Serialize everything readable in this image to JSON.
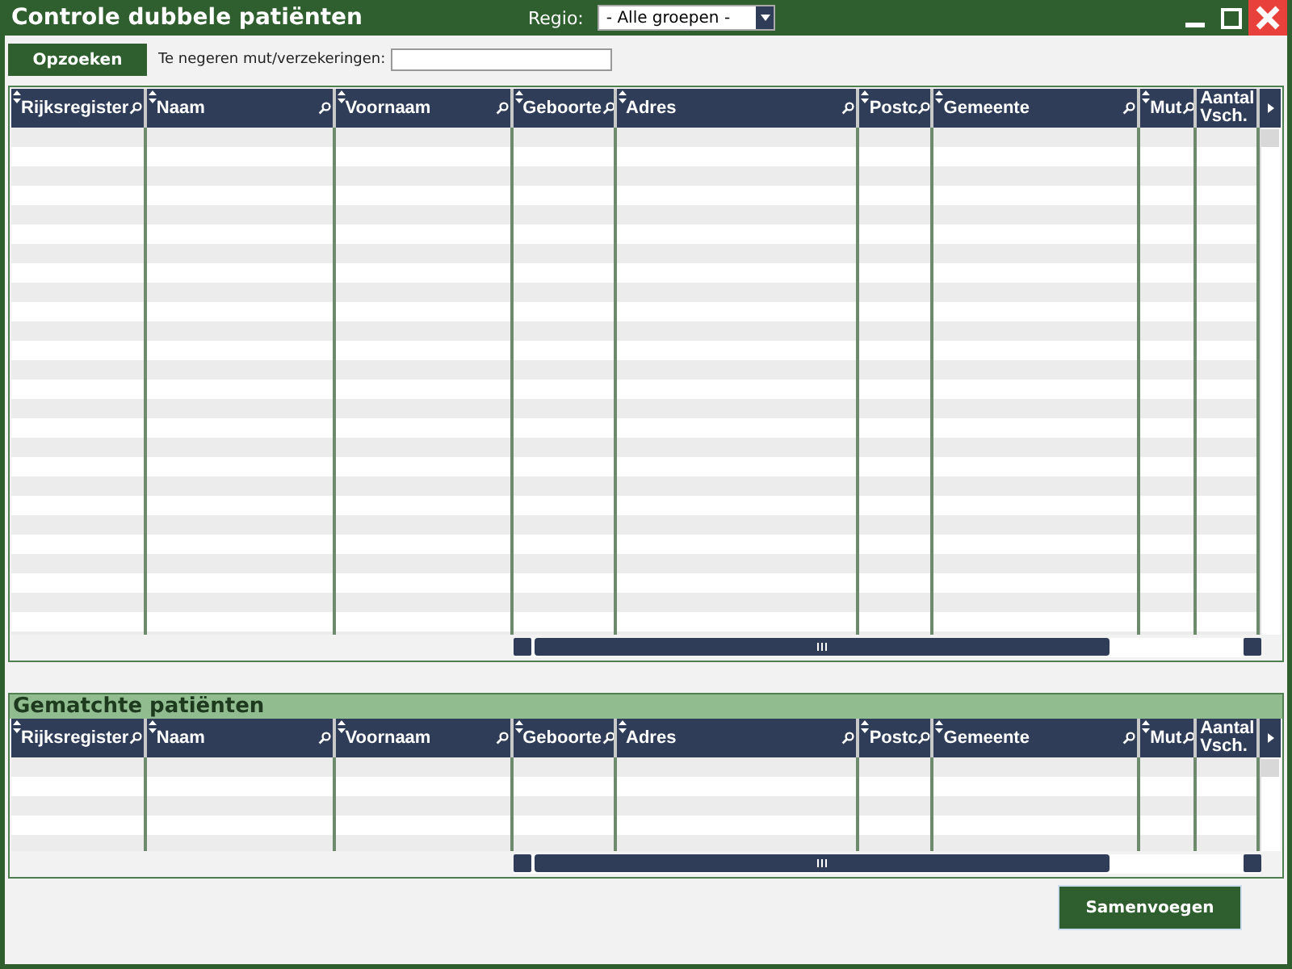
{
  "window": {
    "title": "Controle dubbele patiënten"
  },
  "region": {
    "label": "Regio:",
    "value": "- Alle groepen -"
  },
  "toolbar": {
    "search_button": "Opzoeken",
    "ignore_label": "Te negeren mut/verzekeringen:"
  },
  "grids": [
    {
      "columns": [
        {
          "label": "Rijksregister",
          "filter": true
        },
        {
          "label": "Naam",
          "filter": true
        },
        {
          "label": "Voornaam",
          "filter": true
        },
        {
          "label": "Geboorte",
          "filter": true
        },
        {
          "label": "Adres",
          "filter": true
        },
        {
          "label": "Postc",
          "filter": true
        },
        {
          "label": "Gemeente",
          "filter": true
        },
        {
          "label": "Mut",
          "filter": true
        },
        {
          "label": "Aantal Vsch.",
          "filter": false
        }
      ]
    },
    {
      "caption": "Gematchte patiënten",
      "columns": [
        {
          "label": "Rijksregister",
          "filter": true
        },
        {
          "label": "Naam",
          "filter": true
        },
        {
          "label": "Voornaam",
          "filter": true
        },
        {
          "label": "Geboorte",
          "filter": true
        },
        {
          "label": "Adres",
          "filter": true
        },
        {
          "label": "Postc",
          "filter": true
        },
        {
          "label": "Gemeente",
          "filter": true
        },
        {
          "label": "Mut",
          "filter": true
        },
        {
          "label": "Aantal Vsch.",
          "filter": false
        }
      ]
    }
  ],
  "merge_button": "Samenvoegen"
}
